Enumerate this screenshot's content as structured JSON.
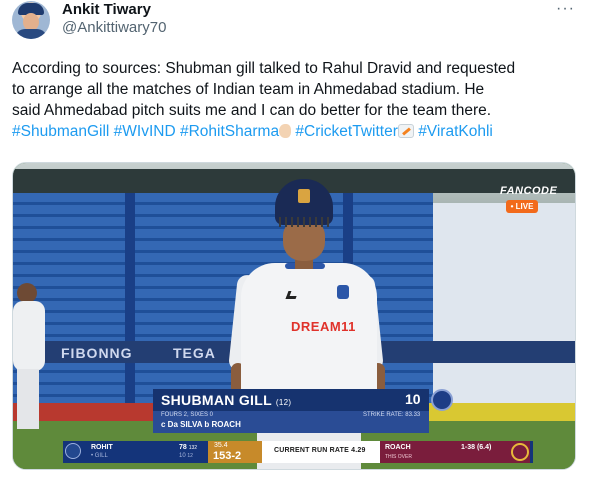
{
  "author": {
    "name": "Ankit Tiwary",
    "handle": "@Ankittiwary70"
  },
  "menu_label": "···",
  "tweet": {
    "line1": "According to sources: Shubman gill talked to Rahul Dravid and requested",
    "line2": "to arrange all the matches of Indian team in Ahmedabad stadium. He",
    "line3": "said Ahmedabad pitch suits me and I can do better for the team there.",
    "hashtags": [
      "#ShubmanGill",
      "#WIvIND",
      "#RohitSharma",
      "#CricketTwitter",
      "#ViratKohli"
    ]
  },
  "broadcast": {
    "channel": "FANCODE",
    "live": "• LIVE",
    "boards": [
      "FIBONNG",
      "TEGA"
    ],
    "sponsor": "DREAM11",
    "batter": {
      "name": "SHUBMAN GILL",
      "balls": "(12)",
      "runs": "10",
      "boundaries": "FOURS 2, SIXES 0",
      "dismissal": "c Da SILVA  b ROACH",
      "strike_rate": "STRIKE RATE: 83.33"
    },
    "strip": {
      "batter1_name": "ROHIT",
      "batter1_score": "78",
      "batter1_balls": "132",
      "batter2_name": "• GILL",
      "batter2_score": "10",
      "batter2_balls": "12",
      "overs": "35.4",
      "team_score": "153-2",
      "run_rate": "CURRENT RUN RATE 4.29",
      "bowler": "ROACH",
      "bowler_figures": "1-38 (6.4)",
      "this_over": "THIS OVER"
    }
  }
}
